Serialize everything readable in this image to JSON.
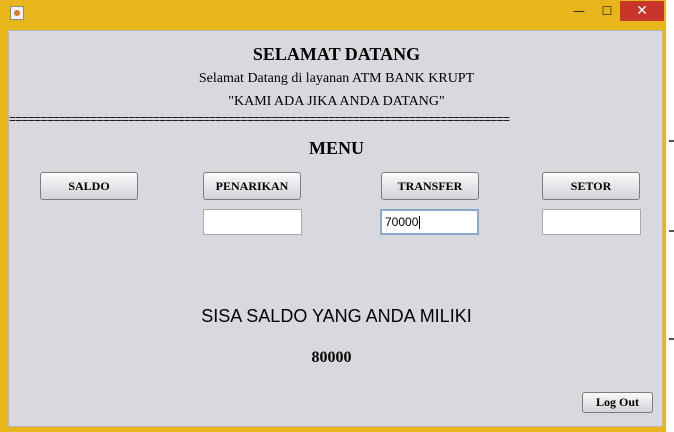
{
  "window": {
    "title": "",
    "controls": {
      "minimize": "—",
      "maximize": "☐",
      "close": "✕"
    }
  },
  "header": {
    "title": "SELAMAT DATANG",
    "subtitle": "Selamat Datang di layanan ATM BANK KRUPT",
    "tagline": "\"KAMI ADA JIKA ANDA DATANG\"",
    "divider": "================================================================================"
  },
  "menu": {
    "title": "MENU",
    "buttons": {
      "saldo": "SALDO",
      "penarikan": "PENARIKAN",
      "transfer": "TRANSFER",
      "setor": "SETOR"
    },
    "inputs": {
      "penarikan": "",
      "transfer": "70000",
      "setor": ""
    }
  },
  "balance": {
    "label": "SISA SALDO YANG ANDA MILIKI",
    "value": "80000"
  },
  "footer": {
    "logout": "Log Out"
  },
  "colors": {
    "frame": "#e8b51a",
    "panel": "#d8d9de",
    "close": "#c8352b"
  }
}
